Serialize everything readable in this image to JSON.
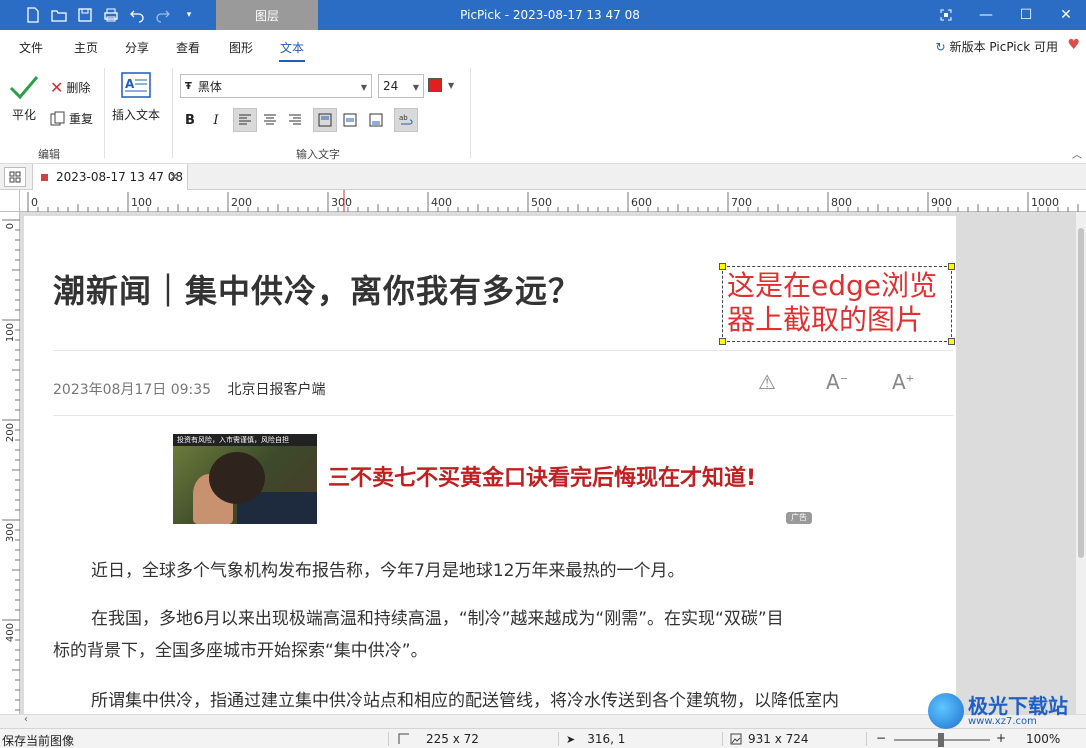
{
  "titlebar": {
    "context_tab": "图层",
    "title": "PicPick - 2023-08-17 13 47 08"
  },
  "menu": {
    "tabs": [
      "文件",
      "主页",
      "分享",
      "查看",
      "图形",
      "文本"
    ],
    "active": "文本",
    "update_notice": "新版本 PicPick 可用"
  },
  "ribbon": {
    "apply_label": "平化",
    "delete_label": "删除",
    "redo_label": "重复",
    "insert_text_label": "插入文本",
    "group_edit": "编辑",
    "group_input": "输入文字",
    "font_name": "黑体",
    "font_size": "24",
    "text_color": "#e02020"
  },
  "doc_tab": {
    "name": "2023-08-17 13 47 08"
  },
  "ruler": {
    "h_ticks": [
      "0",
      "100",
      "200",
      "300",
      "400",
      "500",
      "600",
      "700",
      "800",
      "900",
      "1000"
    ],
    "v_ticks": [
      "0",
      "100",
      "200",
      "300",
      "400"
    ]
  },
  "page": {
    "title": "潮新闻｜集中供冷，离你我有多远？",
    "date": "2023年08月17日 09:35",
    "source": "北京日报客户端",
    "ad_caption": "投资有风险，入市需谨慎，风险自担",
    "ad_text": "三不卖七不买黄金口诀看完后悔现在才知道!",
    "ad_badge": "广告",
    "paragraphs": [
      "近日，全球多个气象机构发布报告称，今年7月是地球12万年来最热的一个月。",
      "在我国，多地6月以来出现极端高温和持续高温，“制冷”越来越成为“刚需”。在实现“双碳”目",
      "标的背景下，全国多座城市开始探索“集中供冷”。",
      "所谓集中供冷，指通过建立集中供冷站点和相应的配送管线，将冷水传送到各个建筑物，以降低室内"
    ],
    "overlay_line1": "这是在edge浏览",
    "overlay_line2": "器上截取的图片"
  },
  "status": {
    "left": "保存当前图像",
    "selection_size": "225 x 72",
    "cursor_pos": "316, 1",
    "image_size": "931 x 724",
    "zoom": "100%"
  },
  "watermark": {
    "title": "极光下载站",
    "url": "www.xz7.com"
  }
}
